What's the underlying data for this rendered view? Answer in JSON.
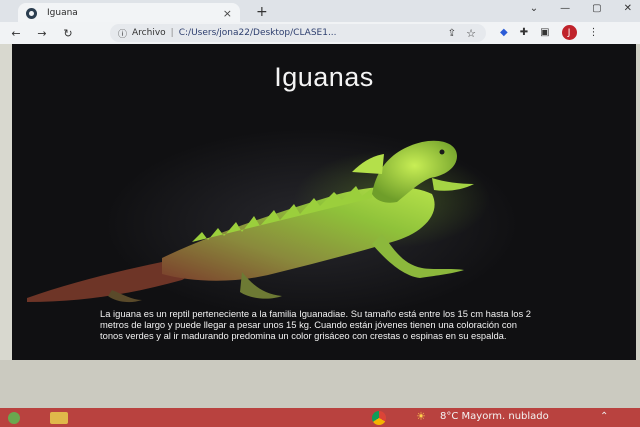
{
  "browser": {
    "tab_title": "Iguana",
    "tab_close": "×",
    "new_tab": "+",
    "window_buttons": [
      "⌄",
      "—",
      "▢",
      "✕"
    ],
    "back": "←",
    "forward": "→",
    "reload": "↻",
    "security_label": "Archivo",
    "address": "C:/Users/jona22/Desktop/CLASE1...",
    "profile_initial": "J"
  },
  "page": {
    "title": "Iguanas",
    "description": "La iguana es un reptil perteneciente a la familia Iguanadiae. Su tamaño está entre los 15 cm hasta los 2 metros de largo y puede llegar a pesar unos 15 kg. Cuando están jóvenes tienen una coloración con tonos verdes y al ir madurando predomina un color grisáceo con crestas o espinas en su espalda."
  },
  "taskbar": {
    "temperature": "8°C",
    "weather": "Mayorm. nublado"
  },
  "colors": {
    "page_bg": "#151518",
    "title_text": "#f4f4f4",
    "iguana_green": "#9acd32",
    "taskbar": "#b9423f"
  }
}
